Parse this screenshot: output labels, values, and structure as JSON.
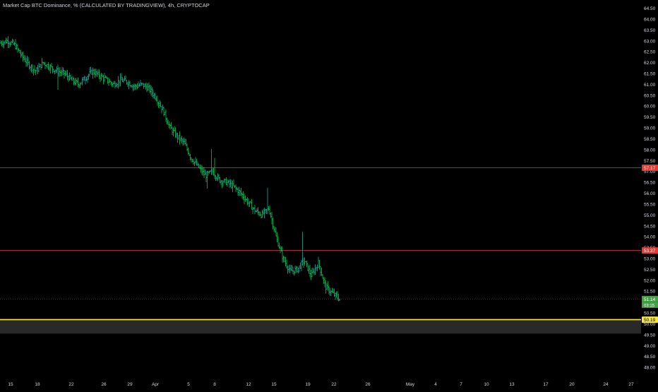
{
  "header": {
    "title": "Market Cap BTC Dominance, % (CALCULATED BY TRADINGVIEW), 4h, CRYPTOCAP"
  },
  "colors": {
    "background": "#000000",
    "axis_text": "#d1d4dc",
    "bar_up": "#26a69a",
    "bar_down": "#00c853",
    "hline": "#e53935",
    "current_price": "#43a047",
    "highlight": "#f5e642",
    "zone": "#3a3a3a"
  },
  "chart_data": {
    "type": "ohlc",
    "title": "Market Cap BTC Dominance, % (CALCULATED BY TRADINGVIEW), 4h, CRYPTOCAP",
    "ylim": [
      47.55,
      64.55
    ],
    "xlim": [
      0,
      896
    ],
    "y_ticks": [
      "64.50",
      "64.00",
      "63.50",
      "63.00",
      "62.50",
      "62.00",
      "61.50",
      "61.00",
      "60.50",
      "60.00",
      "59.50",
      "59.00",
      "58.50",
      "58.00",
      "57.50",
      "57.00",
      "56.50",
      "56.00",
      "55.50",
      "55.00",
      "54.50",
      "54.00",
      "53.50",
      "53.00",
      "52.50",
      "52.00",
      "51.50",
      "51.00",
      "50.50",
      "50.00",
      "49.50",
      "49.00",
      "48.50",
      "48.00"
    ],
    "x_ticks": [
      {
        "label": "15",
        "x": 15
      },
      {
        "label": "18",
        "x": 53
      },
      {
        "label": "22",
        "x": 101
      },
      {
        "label": "26",
        "x": 147
      },
      {
        "label": "29",
        "x": 184
      },
      {
        "label": "Apr",
        "x": 220
      },
      {
        "label": "5",
        "x": 267
      },
      {
        "label": "8",
        "x": 304
      },
      {
        "label": "12",
        "x": 352
      },
      {
        "label": "15",
        "x": 388
      },
      {
        "label": "19",
        "x": 436
      },
      {
        "label": "22",
        "x": 473
      },
      {
        "label": "26",
        "x": 521
      },
      {
        "label": "May",
        "x": 581
      },
      {
        "label": "4",
        "x": 617
      },
      {
        "label": "7",
        "x": 653
      },
      {
        "label": "10",
        "x": 689
      },
      {
        "label": "13",
        "x": 725
      },
      {
        "label": "17",
        "x": 773
      },
      {
        "label": "20",
        "x": 810
      },
      {
        "label": "24",
        "x": 858
      },
      {
        "label": "27",
        "x": 894
      }
    ],
    "horizontal_lines": [
      {
        "value": 57.17,
        "label": "57.17",
        "color": "#e53935"
      },
      {
        "value": 53.37,
        "label": "53.37",
        "color": "#e53935"
      }
    ],
    "current_price": {
      "value": 51.14,
      "label": "51.14",
      "countdown": "03:15"
    },
    "highlight_level": {
      "value": 50.19,
      "label": "50.19"
    },
    "zone": {
      "from": 49.55,
      "to": 50.25
    },
    "price_path": [
      [
        0,
        62.9
      ],
      [
        10,
        63.0
      ],
      [
        20,
        62.8
      ],
      [
        30,
        62.3
      ],
      [
        40,
        61.9
      ],
      [
        50,
        61.6
      ],
      [
        60,
        62.0
      ],
      [
        70,
        61.8
      ],
      [
        80,
        61.6
      ],
      [
        90,
        61.5
      ],
      [
        100,
        61.2
      ],
      [
        110,
        61.0
      ],
      [
        120,
        61.3
      ],
      [
        130,
        61.6
      ],
      [
        140,
        61.4
      ],
      [
        150,
        61.2
      ],
      [
        160,
        61.0
      ],
      [
        170,
        61.2
      ],
      [
        180,
        61.1
      ],
      [
        190,
        60.9
      ],
      [
        200,
        61.0
      ],
      [
        210,
        60.8
      ],
      [
        220,
        60.4
      ],
      [
        230,
        59.8
      ],
      [
        240,
        59.0
      ],
      [
        250,
        58.6
      ],
      [
        260,
        58.3
      ],
      [
        270,
        57.6
      ],
      [
        280,
        57.2
      ],
      [
        290,
        56.8
      ],
      [
        300,
        57.0
      ],
      [
        310,
        56.6
      ],
      [
        320,
        56.5
      ],
      [
        330,
        56.3
      ],
      [
        340,
        56.0
      ],
      [
        350,
        55.6
      ],
      [
        360,
        55.2
      ],
      [
        370,
        55.0
      ],
      [
        380,
        55.3
      ],
      [
        390,
        54.0
      ],
      [
        400,
        53.0
      ],
      [
        410,
        52.4
      ],
      [
        420,
        52.5
      ],
      [
        430,
        52.9
      ],
      [
        440,
        52.2
      ],
      [
        450,
        52.8
      ],
      [
        460,
        51.7
      ],
      [
        470,
        51.4
      ],
      [
        480,
        51.14
      ]
    ]
  }
}
